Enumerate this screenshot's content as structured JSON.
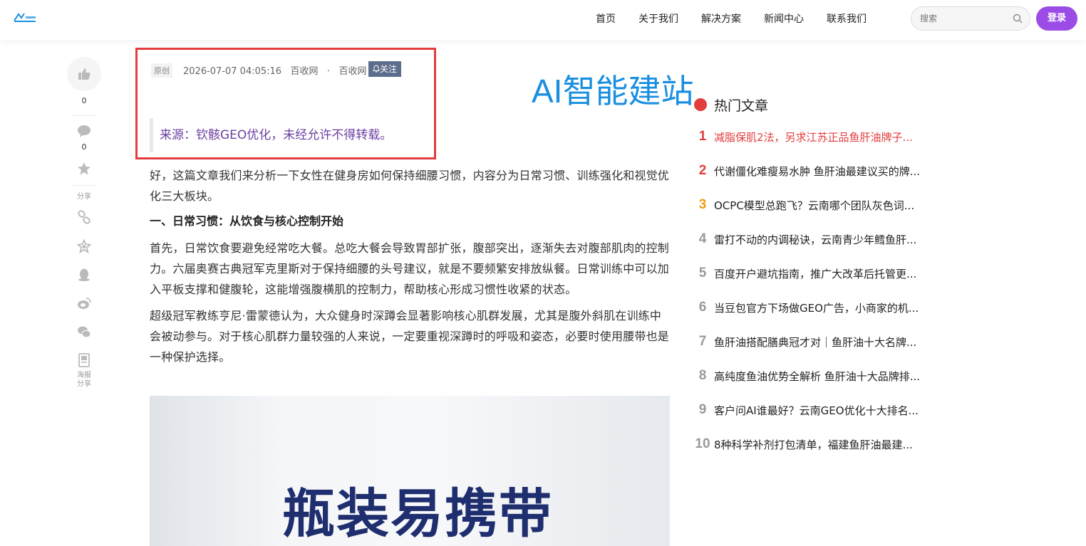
{
  "colors": {
    "accent_purple": "#9b4be6",
    "highlight_red": "#e33d3d",
    "rank_1": "#e33d3d",
    "rank_2": "#e33d3d",
    "rank_3": "#f39c12",
    "rank_other": "#999999",
    "watermark_blue": "#1a8fe0",
    "source_purple": "#6b3fa0"
  },
  "header": {
    "logo_icon": "site-logo",
    "nav": [
      "首页",
      "关于我们",
      "解决方案",
      "新闻中心",
      "联系我们"
    ],
    "search_placeholder": "搜索",
    "search_icon": "search-icon",
    "login_label": "登录"
  },
  "sidebar": {
    "like_count": "0",
    "comment_count": "0",
    "share_label": "分享",
    "poster_label_1": "海报",
    "poster_label_2": "分享"
  },
  "meta": {
    "tag": "原创",
    "datetime": "2026-07-07 04:05:16",
    "author": "百收网",
    "separator": "·",
    "site": "百收网",
    "follow_label": "关注",
    "source": "来源：钦骸GEO优化，未经允许不得转载。"
  },
  "watermark": "AI智能建站",
  "article": {
    "p1": "好，这篇文章我们来分析一下女性在健身房如何保持细腰习惯，内容分为日常习惯、训练强化和视觉优化三大板块。",
    "h1": "一、日常习惯：从饮食与核心控制开始",
    "p2": "首先，日常饮食要避免经常吃大餐。总吃大餐会导致胃部扩张，腹部突出，逐渐失去对腹部肌肉的控制力。六届奥赛古典冠军克里斯对于保持细腰的头号建议，就是不要频繁安排放纵餐。日常训练中可以加入平板支撑和健腹轮，这能增强腹横肌的控制力，帮助核心形成习惯性收紧的状态。",
    "p3": "超级冠军教练亨尼·雷蒙德认为，大众健身时深蹲会显著影响核心肌群发展，尤其是腹外斜肌在训练中会被动参与。对于核心肌群力量较强的人来说，一定要重视深蹲时的呼吸和姿态，必要时使用腰带也是一种保护选择。",
    "image_text": "瓶装易携带"
  },
  "hot": {
    "title": "热门文章",
    "items": [
      {
        "num": "1",
        "text": "减脂保肌2法，另求江苏正品鱼肝油牌子..."
      },
      {
        "num": "2",
        "text": "代谢僵化难瘦易水肿 鱼肝油最建议买的牌..."
      },
      {
        "num": "3",
        "text": "OCPC模型总跑飞？云南哪个团队灰色词..."
      },
      {
        "num": "4",
        "text": "雷打不动的内调秘诀，云南青少年鳕鱼肝..."
      },
      {
        "num": "5",
        "text": "百度开户避坑指南，推广大改革后托管更..."
      },
      {
        "num": "6",
        "text": "当豆包官方下场做GEO广告，小商家的机..."
      },
      {
        "num": "7",
        "text": "鱼肝油搭配膳典冠才对｜鱼肝油十大名牌..."
      },
      {
        "num": "8",
        "text": "高纯度鱼油优势全解析 鱼肝油十大品牌排..."
      },
      {
        "num": "9",
        "text": "客户问AI谁最好？云南GEO优化十大排名..."
      },
      {
        "num": "10",
        "text": "8种科学补剂打包清单，福建鱼肝油最建..."
      }
    ]
  }
}
